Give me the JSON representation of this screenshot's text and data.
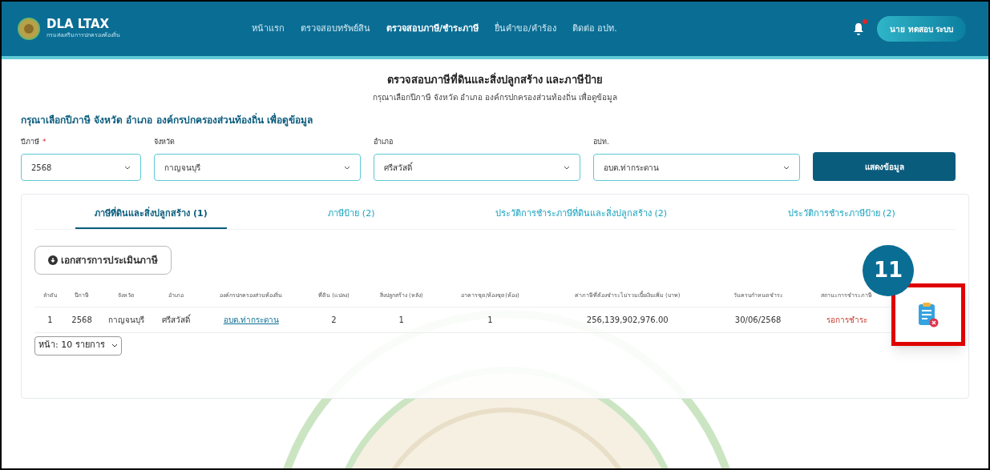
{
  "header": {
    "logo_title": "DLA LTAX",
    "logo_subtitle": "กรมส่งเสริมการปกครองท้องถิ่น",
    "nav": [
      {
        "label": "หน้าแรก",
        "selected": false
      },
      {
        "label": "ตรวจสอบทรัพย์สิน",
        "selected": false
      },
      {
        "label": "ตรวจสอบภาษี/ชำระภาษี",
        "selected": true
      },
      {
        "label": "ยื่นคำขอ/คำร้อง",
        "selected": false
      },
      {
        "label": "ติดต่อ อปท.",
        "selected": false
      }
    ],
    "user": "นาย ทดสอบ ระบบ"
  },
  "page_title": "ตรวจสอบภาษีที่ดินและสิ่งปลูกสร้าง และภาษีป้าย",
  "page_subtitle": "กรุณาเลือกปีภาษี จังหวัด อำเภอ องค์กรปกครองส่วนท้องถิ่น เพื่อดูข้อมูล",
  "required_mark": "*",
  "filter_heading": "กรุณาเลือกปีภาษี จังหวัด อำเภอ องค์กรปกครองส่วนท้องถิ่น เพื่อดูข้อมูล",
  "filters": [
    {
      "label": "ปีภาษี",
      "required": true,
      "value": "2568"
    },
    {
      "label": "จังหวัด",
      "required": false,
      "value": "กาญจนบุรี"
    },
    {
      "label": "อำเภอ",
      "required": false,
      "value": "ศรีสวัสดิ์"
    },
    {
      "label": "อปท.",
      "required": false,
      "value": "อบต.ท่ากระดาน"
    }
  ],
  "show_button": "แสดงข้อมูล",
  "tabs": [
    {
      "label": "ภาษีที่ดินและสิ่งปลูกสร้าง (1)",
      "selected": true
    },
    {
      "label": "ภาษีป้าย (2)",
      "selected": false
    },
    {
      "label": "ประวัติการชำระภาษีที่ดินและสิ่งปลูกสร้าง (2)",
      "selected": false
    },
    {
      "label": "ประวัติการชำระภาษีป้าย (2)",
      "selected": false
    }
  ],
  "download_button": "เอกสารการประเมินภาษี",
  "table": {
    "columns": [
      "ลำดับ",
      "ปีภาษี",
      "จังหวัด",
      "อำเภอ",
      "องค์กรปกครองส่วนท้องถิ่น",
      "ที่ดิน (แปลง)",
      "สิ่งปลูกสร้าง (หลัง)",
      "อาคารชุด/ห้องชุด(ห้อง)",
      "ค่าภาษีที่ต้องชำระไม่รวมเบี้ยเงินเพิ่ม (บาท)",
      "วันครบกำหนดชำระ",
      "สถานะการชำระภาษี"
    ],
    "rows": [
      {
        "cells": [
          "1",
          "2568",
          "กาญจนบุรี",
          "ศรีสวัสดิ์",
          "อบต.ท่ากระดาน",
          "2",
          "1",
          "1",
          "256,139,902,976.00",
          "30/06/2568",
          "รอการชำระ"
        ]
      }
    ]
  },
  "page_size": "หน้า: 10 รายการ",
  "callout": {
    "number": "11"
  }
}
